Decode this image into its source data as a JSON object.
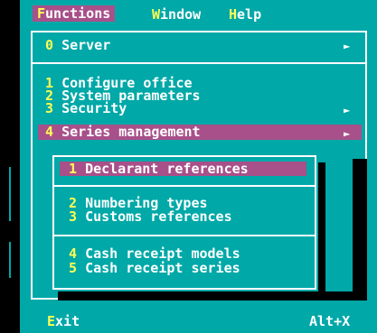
{
  "menubar": {
    "items": [
      {
        "hotkey": "F",
        "rest": "unctions"
      },
      {
        "hotkey": "W",
        "rest": "indow"
      },
      {
        "hotkey": "H",
        "rest": "elp"
      }
    ]
  },
  "functions_menu": {
    "server": {
      "hotkey": "0",
      "label": "Server",
      "arrow": "►"
    },
    "configure_office": {
      "hotkey": "1",
      "label": "Configure office"
    },
    "system_parameters": {
      "hotkey": "2",
      "label": "System parameters"
    },
    "security": {
      "hotkey": "3",
      "label": "Security",
      "arrow": "►"
    },
    "series_management": {
      "hotkey": "4",
      "label": "Series management",
      "arrow": "►"
    }
  },
  "series_submenu": {
    "declarant_references": {
      "hotkey": "1",
      "label": "Declarant references"
    },
    "numbering_types": {
      "hotkey": "2",
      "label": "Numbering types"
    },
    "customs_references": {
      "hotkey": "3",
      "label": "Customs references"
    },
    "cash_receipt_models": {
      "hotkey": "4",
      "label": "Cash receipt models"
    },
    "cash_receipt_series": {
      "hotkey": "5",
      "label": "Cash receipt series"
    }
  },
  "status": {
    "exit_hotkey": "E",
    "exit_rest": "xit",
    "shortcut": "Alt+X"
  },
  "colors": {
    "background": "#00a8a8",
    "highlight": "#a8508a",
    "hotkey": "#ffff55",
    "text": "#ffffff",
    "shadow": "#000000"
  }
}
